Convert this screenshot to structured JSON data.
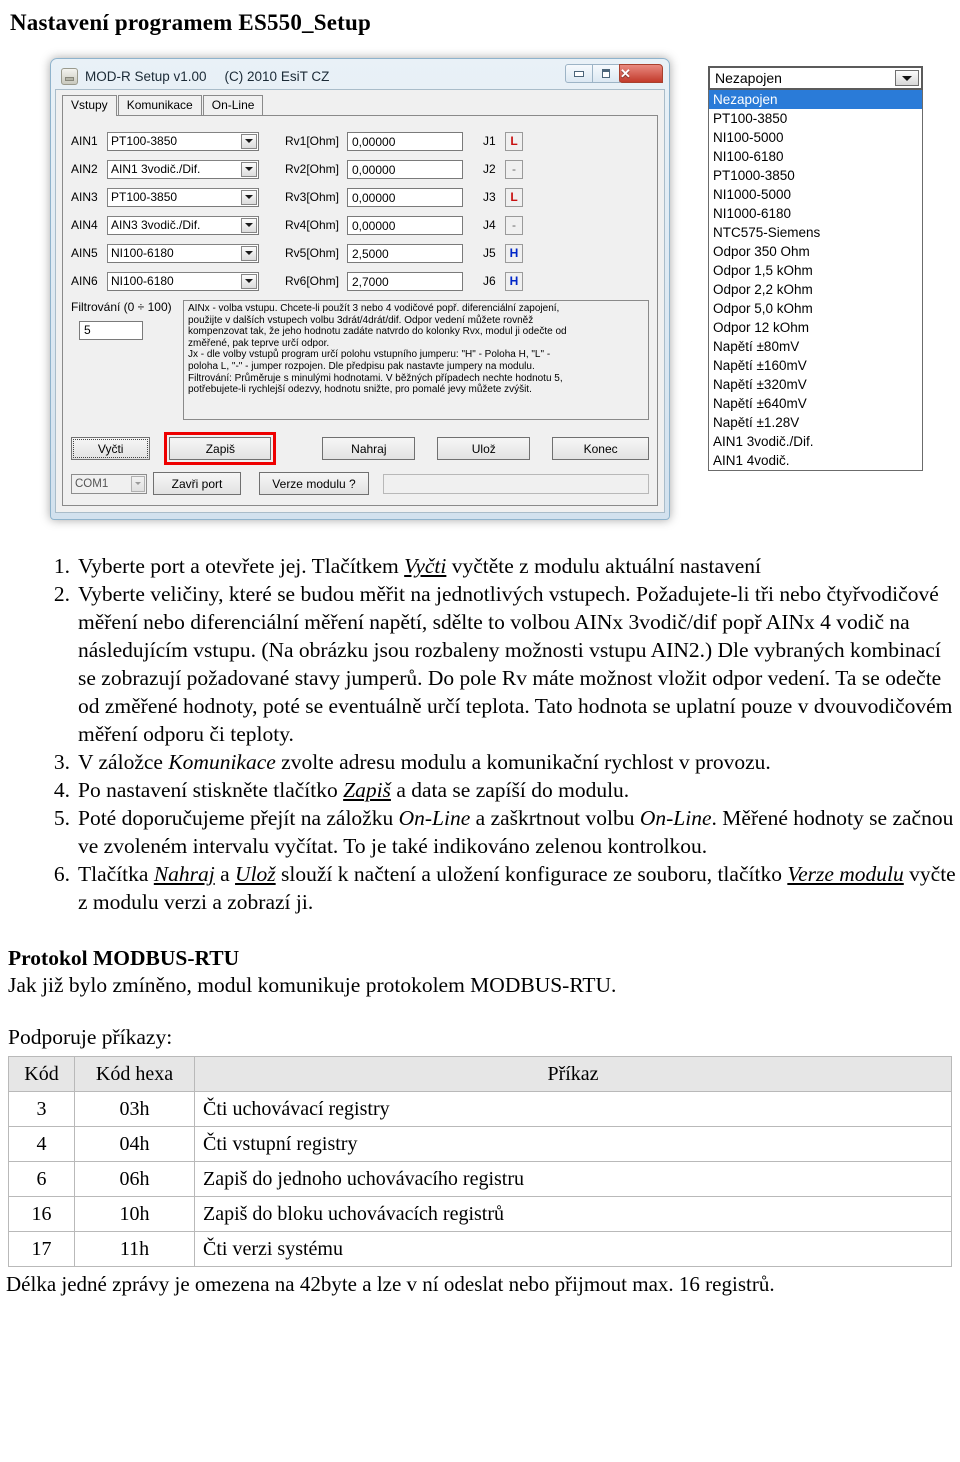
{
  "page": {
    "title": "Nastavení programem ES550_Setup"
  },
  "app_window": {
    "title": "MOD-R Setup v1.00",
    "copyright": "(C) 2010 EsiT CZ",
    "window_buttons": {
      "minimize": "minimize-icon",
      "maximize": "maximize-icon",
      "close": "✕"
    },
    "tabs": [
      {
        "label": "Vstupy",
        "active": true
      },
      {
        "label": "Komunikace",
        "active": false
      },
      {
        "label": "On-Line",
        "active": false
      }
    ],
    "input_rows": [
      {
        "ain_label": "AIN1",
        "ain_accel": "1",
        "sensor": "PT100-3850",
        "rv_label": "Rv1[Ohm]",
        "rv_value": "0,00000",
        "j_label": "J1",
        "j_state": "L"
      },
      {
        "ain_label": "AIN2",
        "ain_accel": "2",
        "sensor": "AIN1 3vodič./Dif.",
        "rv_label": "Rv2[Ohm]",
        "rv_value": "0,00000",
        "j_label": "J2",
        "j_state": "-"
      },
      {
        "ain_label": "AIN3",
        "ain_accel": "3",
        "sensor": "PT100-3850",
        "rv_label": "Rv3[Ohm]",
        "rv_value": "0,00000",
        "j_label": "J3",
        "j_state": "L"
      },
      {
        "ain_label": "AIN4",
        "ain_accel": "4",
        "sensor": "AIN3 3vodič./Dif.",
        "rv_label": "Rv4[Ohm]",
        "rv_value": "0,00000",
        "j_label": "J4",
        "j_state": "-"
      },
      {
        "ain_label": "AIN5",
        "ain_accel": "5",
        "sensor": "NI100-6180",
        "rv_label": "Rv5[Ohm]",
        "rv_value": "2,5000",
        "j_label": "J5",
        "j_state": "H"
      },
      {
        "ain_label": "AIN6",
        "ain_accel": "6",
        "sensor": "NI100-6180",
        "rv_label": "Rv6[Ohm]",
        "rv_value": "2,7000",
        "j_label": "J6",
        "j_state": "H"
      }
    ],
    "filter": {
      "label": "Filtrování (0 ÷ 100)",
      "value": "5"
    },
    "help_lines": [
      "AINx -  volba vstupu.  Chcete-li použít 3 nebo 4 vodičové popř. diferenciální zapojení,",
      "použijte v dalších vstupech volbu 3drát/4drát/dif.  Odpor vedení můžete rovněž",
      "kompenzovat tak, že jeho hodnotu zadáte natvrdo do kolonky Rvx, modul ji odečte od",
      "změřené, pak teprve  určí odpor.",
      "Jx - dle volby vstupů program určí polohu vstupního jumperu: \"H\" - Poloha H, \"L\" -",
      "poloha L, \"-\" - jumper rozpojen. Dle předpisu pak nastavte jumpery na modulu.",
      "Filtrování: Průměruje s minulými hodnotami. V běžných případech nechte hodnotu 5,",
      "potřebujete-li rychlejší odezvy, hodnotu snižte, pro pomalé jevy můžete zvýšit."
    ],
    "buttons": {
      "vycti": "Vyčti",
      "zapis": "Zapiš",
      "nahraj": "Nahraj",
      "uloz": "Ulož",
      "konec": "Konec",
      "zavri_port": "Zavři port",
      "verze_modulu": "Verze modulu ?"
    },
    "com_port": "COM1",
    "highlight_color": "#ee0000"
  },
  "dropdown": {
    "selected": "Nezapojen",
    "items": [
      "Nezapojen",
      "PT100-3850",
      "NI100-5000",
      "NI100-6180",
      "PT1000-3850",
      "NI1000-5000",
      "NI1000-6180",
      "NTC575-Siemens",
      "Odpor 350 Ohm",
      "Odpor 1,5 kOhm",
      "Odpor 2,2 kOhm",
      "Odpor 5,0 kOhm",
      "Odpor 12 kOhm",
      "Napětí ±80mV",
      "Napětí ±160mV",
      "Napětí ±320mV",
      "Napětí ±640mV",
      "Napětí ±1.28V",
      "AIN1 3vodič./Dif.",
      "AIN1 4vodič."
    ],
    "selected_index": 0
  },
  "instructions": [
    {
      "parts": [
        {
          "t": "Vyberte port a otevřete jej. Tlačítkem "
        },
        {
          "t": "Vyčti",
          "style": "italic-underline"
        },
        {
          "t": " vyčtěte z modulu aktuální nastavení"
        }
      ]
    },
    {
      "parts": [
        {
          "t": "Vyberte veličiny, které se budou měřit na jednotlivých vstupech. Požadujete-li tři nebo čtyřvodičové měření nebo diferenciální měření napětí, sdělte to volbou AINx 3vodič/dif popř AINx 4 vodič na následujícím vstupu. (Na obrázku jsou rozbaleny možnosti vstupu AIN2.) Dle vybraných kombinací se zobrazují požadované stavy jumperů. Do pole Rv máte možnost vložit odpor vedení. Ta se odečte od změřené hodnoty, poté se eventuálně určí teplota. Tato hodnota se uplatní pouze v dvouvodičovém měření odporu či teploty."
        }
      ]
    },
    {
      "parts": [
        {
          "t": "V záložce "
        },
        {
          "t": "Komunikace",
          "style": "italic"
        },
        {
          "t": " zvolte adresu modulu a komunikační rychlost v provozu."
        }
      ]
    },
    {
      "parts": [
        {
          "t": "Po nastavení stiskněte tlačítko "
        },
        {
          "t": "Zapiš",
          "style": "italic-underline"
        },
        {
          "t": " a data se zapíší do modulu."
        }
      ]
    },
    {
      "parts": [
        {
          "t": "Poté doporučujeme přejít na záložku "
        },
        {
          "t": "On-Line",
          "style": "italic"
        },
        {
          "t": " a zaškrtnout volbu "
        },
        {
          "t": "On-Line",
          "style": "italic"
        },
        {
          "t": ". Měřené hodnoty se začnou ve zvoleném intervalu vyčítat. To je také indikováno zelenou kontrolkou."
        }
      ]
    },
    {
      "parts": [
        {
          "t": "Tlačítka "
        },
        {
          "t": "Nahraj",
          "style": "italic-underline"
        },
        {
          "t": " a "
        },
        {
          "t": "Ulož",
          "style": "italic-underline"
        },
        {
          "t": " slouží k načtení a uložení konfigurace ze souboru, tlačítko "
        },
        {
          "t": "Verze modulu",
          "style": "italic-underline"
        },
        {
          "t": " vyčte z modulu verzi a zobrazí ji."
        }
      ]
    }
  ],
  "modbus": {
    "heading": "Protokol MODBUS-RTU",
    "paragraph": "Jak již bylo zmíněno, modul komunikuje protokolem MODBUS-RTU.",
    "subheading": "Podporuje příkazy:",
    "table": {
      "headers": [
        "Kód",
        "Kód hexa",
        "Příkaz"
      ],
      "rows": [
        [
          "3",
          "03h",
          "Čti uchovávací registry"
        ],
        [
          "4",
          "04h",
          "Čti vstupní registry"
        ],
        [
          "6",
          "06h",
          "Zapiš do jednoho uchovávacího registru"
        ],
        [
          "16",
          "10h",
          "Zapiš do bloku uchovávacích registrů"
        ],
        [
          "17",
          "11h",
          "Čti verzi systému"
        ]
      ]
    },
    "footnote": "Délka jedné zprávy je omezena na 42byte a lze v ní odeslat nebo přijmout max. 16 registrů."
  }
}
